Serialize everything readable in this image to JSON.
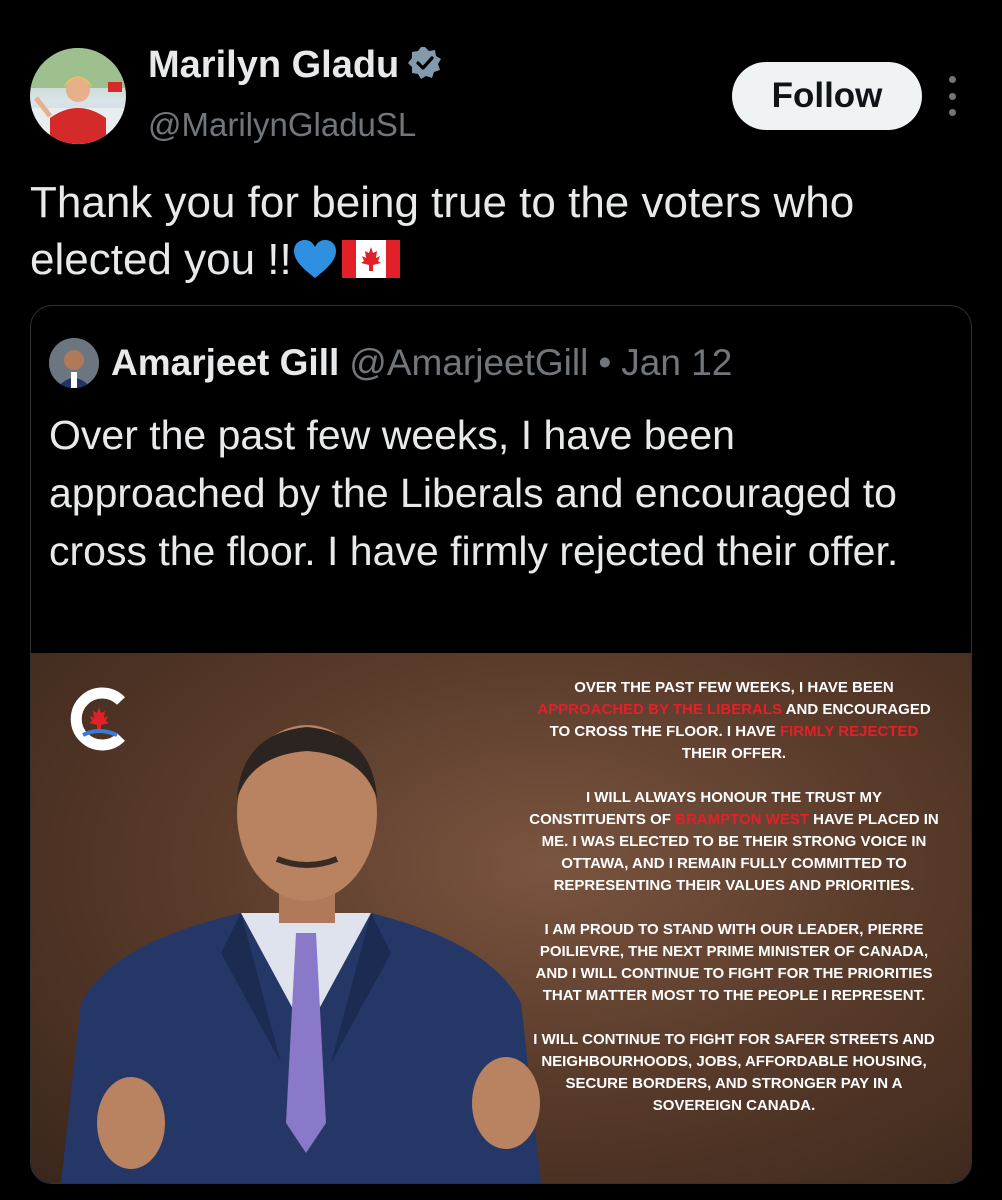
{
  "author": {
    "name": "Marilyn Gladu",
    "handle": "@MarilynGladuSL",
    "verified": true
  },
  "actions": {
    "follow_label": "Follow"
  },
  "tweet": {
    "text": "Thank you for being true to the voters who elected you !!",
    "emojis": [
      "blue-heart",
      "canada-flag"
    ]
  },
  "quoted": {
    "name": "Amarjeet Gill",
    "handle": "@AmarjeetGill",
    "separator": "•",
    "date": "Jan 12",
    "text": "Over the past few weeks, I have been approached by the Liberals and encouraged to cross the floor. I have firmly rejected their offer.",
    "image_statement": {
      "p1_a": "Over the past few weeks, I have been",
      "p1_b": "approached by the Liberals",
      "p1_c": " and encouraged to cross the floor. I have ",
      "p1_d": "firmly rejected",
      "p1_e": " their offer.",
      "p2_a": "I will always honour the trust my constituents of ",
      "p2_b": "Brampton West",
      "p2_c": " have placed in me. I was elected to be their strong voice in Ottawa, and I remain fully committed to representing their values and priorities.",
      "p3": "I am proud to stand with our leader, Pierre Poilievre, the next Prime Minister of Canada, and I will continue to fight for the priorities that matter most to the people I represent.",
      "p4": "I will continue to fight for safer streets and neighbourhoods, jobs, affordable housing, secure borders, and stronger pay in a sovereign Canada."
    }
  },
  "colors": {
    "background": "#000000",
    "text": "#e7e9ea",
    "secondary_text": "#71767b",
    "verified_badge": "#829aab",
    "follow_button_bg": "#eff3f4",
    "highlight_red": "#e2202a"
  }
}
